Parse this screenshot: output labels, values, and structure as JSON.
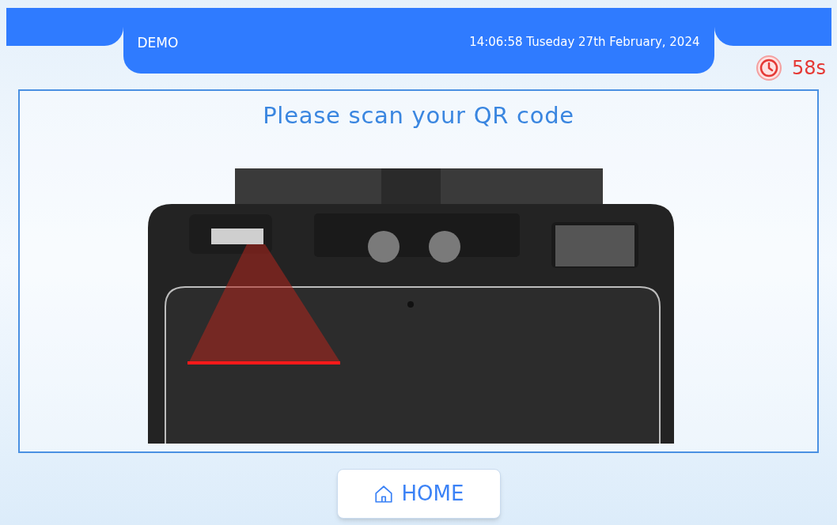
{
  "header": {
    "brand": "DEMO",
    "datetime": "14:06:58 Tuseday 27th February, 2024"
  },
  "timer": {
    "remaining": "58s"
  },
  "prompt": "Please scan your QR code",
  "home_button": {
    "label": "HOME"
  }
}
